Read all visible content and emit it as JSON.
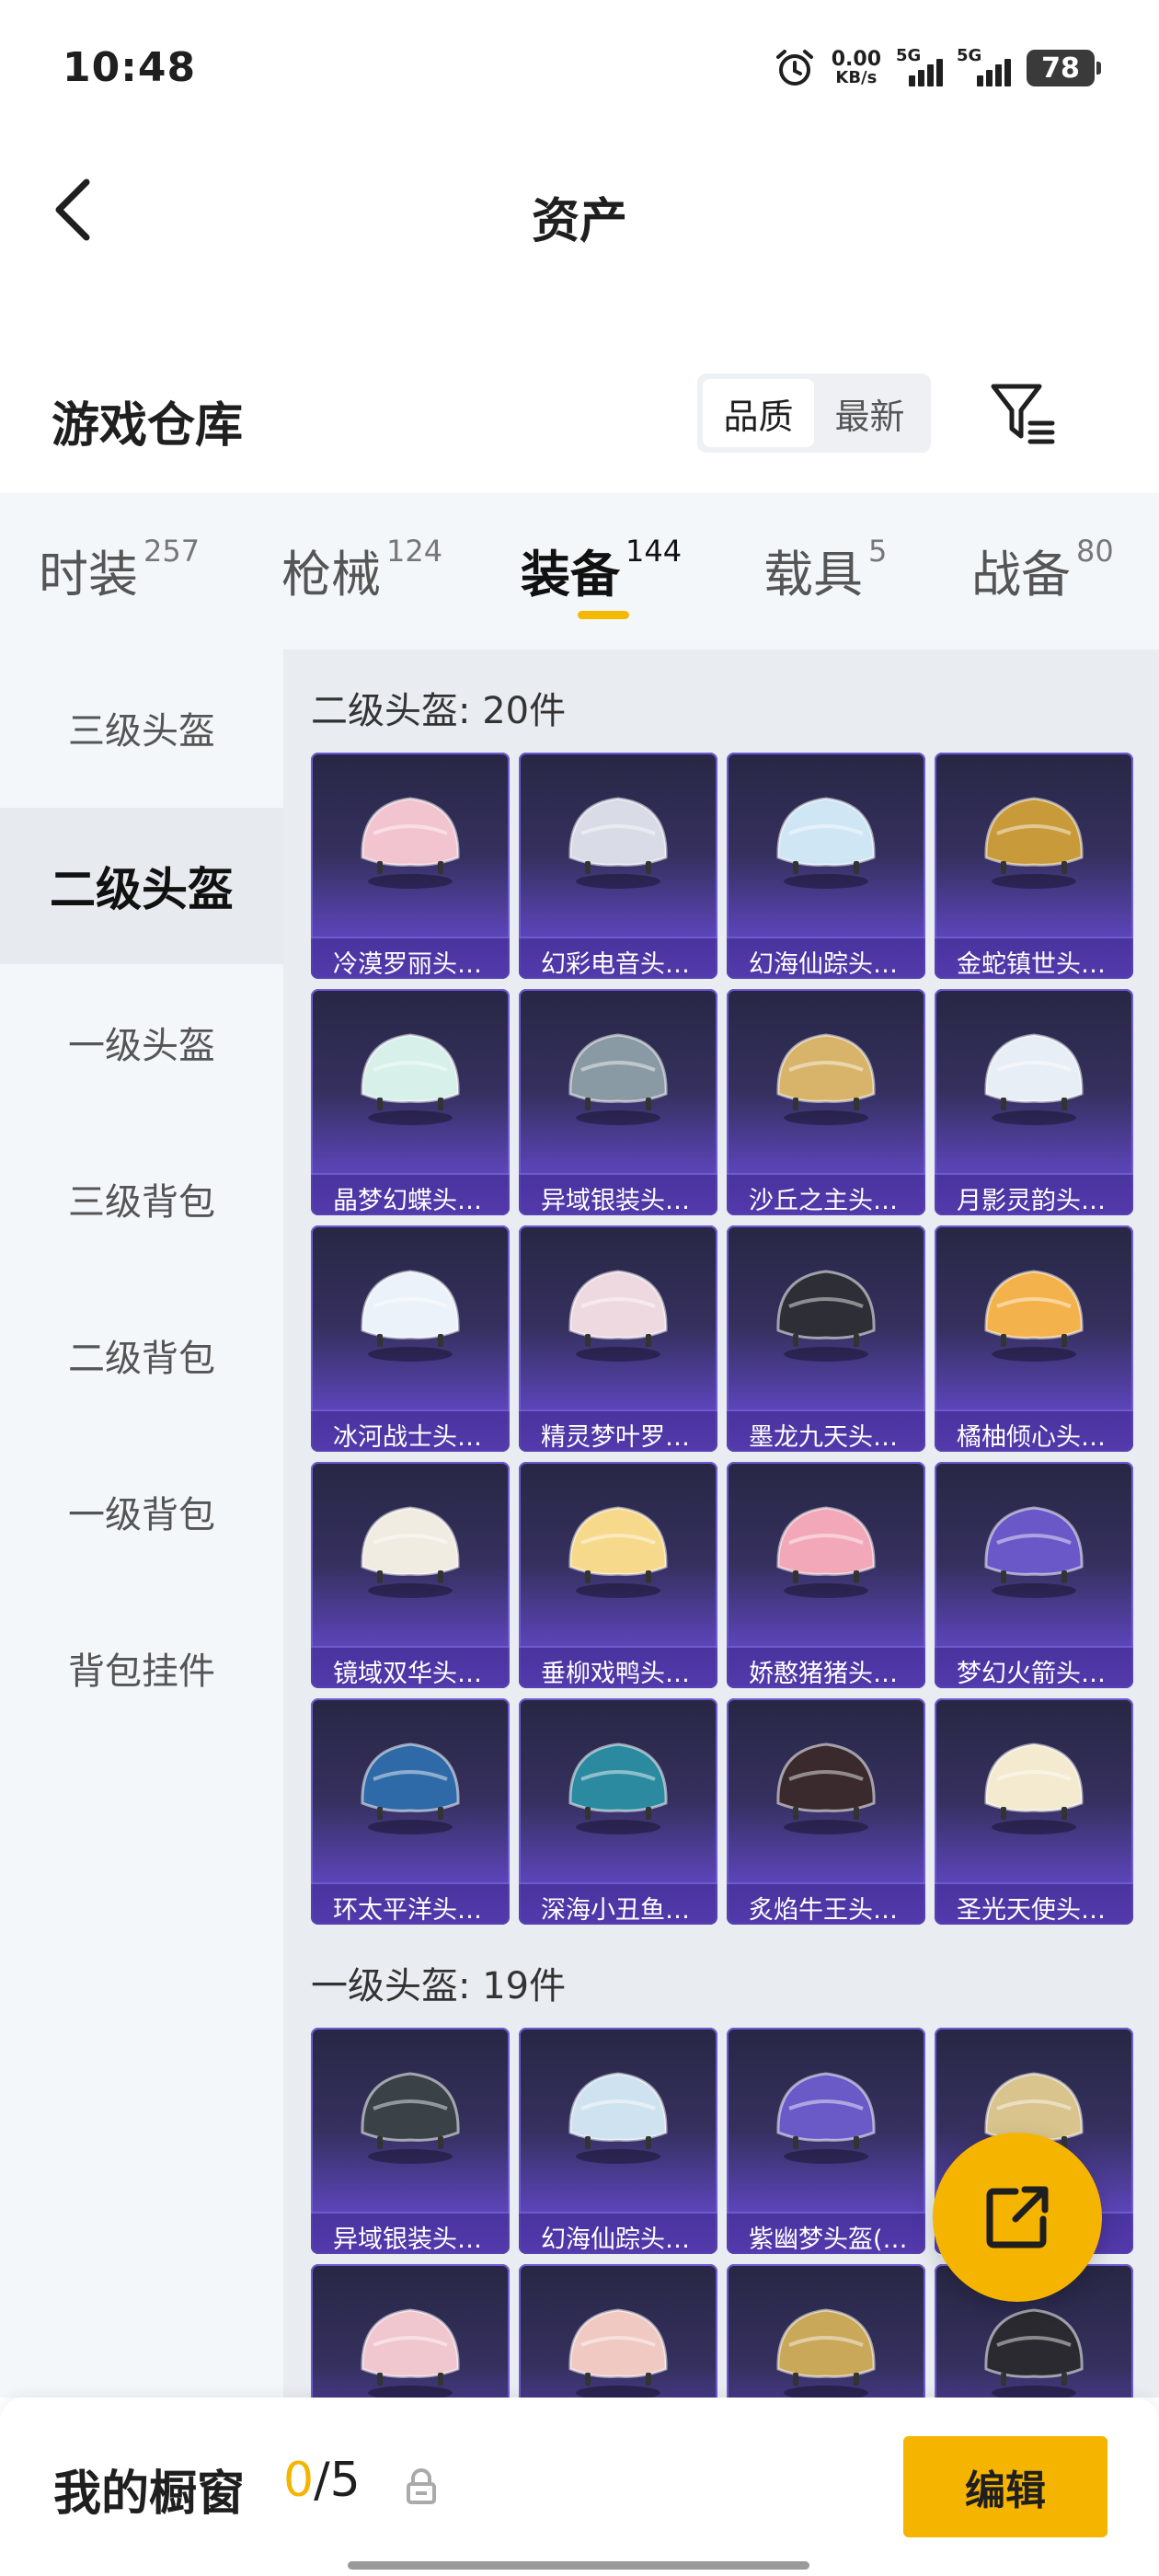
{
  "status": {
    "time": "10:48",
    "net_speed_value": "0.00",
    "net_speed_unit": "KB/s",
    "signal1_label": "5G",
    "signal2_label": "5G",
    "battery": "78"
  },
  "header": {
    "title": "资产"
  },
  "warehouse": {
    "title": "游戏仓库",
    "sort_quality": "品质",
    "sort_newest": "最新"
  },
  "tabs": [
    {
      "label": "时装",
      "count": "257"
    },
    {
      "label": "枪械",
      "count": "124"
    },
    {
      "label": "装备",
      "count": "144"
    },
    {
      "label": "载具",
      "count": "5"
    },
    {
      "label": "战备",
      "count": "80"
    }
  ],
  "sidebar": {
    "items": [
      {
        "label": "三级头盔"
      },
      {
        "label": "二级头盔"
      },
      {
        "label": "一级头盔"
      },
      {
        "label": "三级背包"
      },
      {
        "label": "二级背包"
      },
      {
        "label": "一级背包"
      },
      {
        "label": "背包挂件"
      }
    ]
  },
  "sections": [
    {
      "title": "二级头盔: 20件",
      "items": [
        {
          "name": "冷漠罗丽头…",
          "color": "#f2c4d0"
        },
        {
          "name": "幻彩电音头…",
          "color": "#d9dbe6"
        },
        {
          "name": "幻海仙踪头…",
          "color": "#cfe6f4"
        },
        {
          "name": "金蛇镇世头…",
          "color": "#c89a3a"
        },
        {
          "name": "晶梦幻蝶头…",
          "color": "#d8f0ea"
        },
        {
          "name": "异域银装头…",
          "color": "#8a9aa4"
        },
        {
          "name": "沙丘之主头…",
          "color": "#d8b46a"
        },
        {
          "name": "月影灵韵头…",
          "color": "#e8eef6"
        },
        {
          "name": "冰河战士头…",
          "color": "#ecf2fa"
        },
        {
          "name": "精灵梦叶罗…",
          "color": "#efd9e1"
        },
        {
          "name": "墨龙九天头…",
          "color": "#2e2e36"
        },
        {
          "name": "橘柚倾心头…",
          "color": "#f4b24c"
        },
        {
          "name": "镜域双华头…",
          "color": "#f1ece2"
        },
        {
          "name": "垂柳戏鸭头…",
          "color": "#f6d98a"
        },
        {
          "name": "娇憨猪猪头…",
          "color": "#f2a8b8"
        },
        {
          "name": "梦幻火箭头…",
          "color": "#6b58c8"
        },
        {
          "name": "环太平洋头…",
          "color": "#2f6aa8"
        },
        {
          "name": "深海小丑鱼…",
          "color": "#2b8aa0"
        },
        {
          "name": "炙焰牛王头…",
          "color": "#3a2a2e"
        },
        {
          "name": "圣光天使头…",
          "color": "#f3ead0"
        }
      ]
    },
    {
      "title": "一级头盔: 19件",
      "items": [
        {
          "name": "异域银装头…",
          "color": "#3a4248"
        },
        {
          "name": "幻海仙踪头…",
          "color": "#cfe2ef"
        },
        {
          "name": "紫幽梦头盔(…",
          "color": "#6a5ac8"
        },
        {
          "name": "",
          "color": "#d9c48e"
        },
        {
          "name": "",
          "color": "#f0c6cf"
        },
        {
          "name": "",
          "color": "#efc9c2"
        },
        {
          "name": "",
          "color": "#c9a85a"
        },
        {
          "name": "",
          "color": "#2a2a30"
        }
      ]
    }
  ],
  "bottom": {
    "showcase_label": "我的橱窗",
    "showcase_current": "0",
    "showcase_total": "/5",
    "edit_label": "编辑"
  }
}
